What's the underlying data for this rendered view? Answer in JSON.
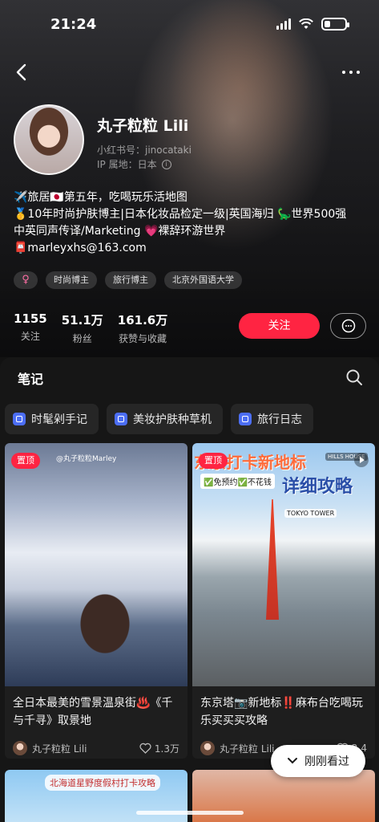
{
  "status": {
    "time": "21:24",
    "battery_level": 0.3
  },
  "profile": {
    "name": "丸子粒粒 Lili",
    "red_id": "小红书号：jinocataki",
    "ip": "IP 属地：日本",
    "bio": [
      "✈️旅居🇯🇵第五年，吃喝玩乐活地图",
      "🥇10年时尚护肤博主|日本化妆品检定一级|英国海归 🦕世界500强",
      "中英同声传译/Marketing 💗裸辞环游世界",
      "📮marleyxhs@163.com"
    ],
    "tags": [
      "时尚博主",
      "旅行博主",
      "北京外国语大学"
    ],
    "gender_symbol": "♀",
    "stats": [
      {
        "num": "1155",
        "label": "关注"
      },
      {
        "num": "51.1万",
        "label": "粉丝"
      },
      {
        "num": "161.6万",
        "label": "获赞与收藏"
      }
    ],
    "follow_label": "关注"
  },
  "notes_tab": {
    "label": "笔记"
  },
  "collections": [
    "时髦剁手记",
    "美妆护肤种草机",
    "旅行日志"
  ],
  "cards": [
    {
      "pin": "置顶",
      "caption": "@丸子粒粒Marley",
      "title": "全日本最美的雪景温泉街♨️《千与千寻》取景地",
      "author": "丸子粒粒 Lili",
      "likes": "1.3万"
    },
    {
      "pin": "置顶",
      "overlay_1": "东京打卡新地标",
      "overlay_2": "详细攻略",
      "badge": "✅免预约✅不花钱",
      "tokyo_label": "TOKYO TOWER",
      "hills_label": "HILLS HOUSE",
      "title": "东京塔📷新地标‼️麻布台吃喝玩乐买买买攻略",
      "author": "丸子粒粒 Lili",
      "likes": "2.4"
    },
    {
      "strip": "北海道星野度假村打卡攻略"
    },
    {
      "strip": ""
    }
  ],
  "float_button": {
    "label": "刚刚看过"
  }
}
